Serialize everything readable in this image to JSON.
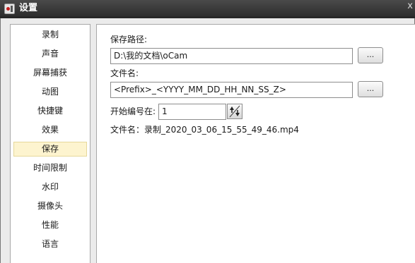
{
  "window": {
    "title": "设置",
    "close_glyph": "x"
  },
  "sidebar": {
    "items": [
      {
        "label": "录制"
      },
      {
        "label": "声音"
      },
      {
        "label": "屏幕捕获"
      },
      {
        "label": "动图"
      },
      {
        "label": "快捷键"
      },
      {
        "label": "效果"
      },
      {
        "label": "保存",
        "selected": true
      },
      {
        "label": "时间限制"
      },
      {
        "label": "水印"
      },
      {
        "label": "摄像头"
      },
      {
        "label": "性能"
      },
      {
        "label": "语言"
      }
    ]
  },
  "save": {
    "path_label": "保存路径:",
    "path_value": "D:\\我的文档\\oCam",
    "browse_label": "...",
    "filename_label": "文件名:",
    "filename_value": "<Prefix>_<YYYY_MM_DD_HH_NN_SS_Z>",
    "start_number_label": "开始编号在:",
    "start_number_value": "1",
    "preview_text": "文件名：录制_2020_03_06_15_55_49_46.mp4"
  },
  "colors": {
    "selected_bg": "#fdf4cf",
    "titlebar": "#2c2c2c"
  },
  "icons": {
    "app": "ocam-app-icon",
    "close": "close-icon",
    "spinner": "spinner-arrows-icon"
  }
}
